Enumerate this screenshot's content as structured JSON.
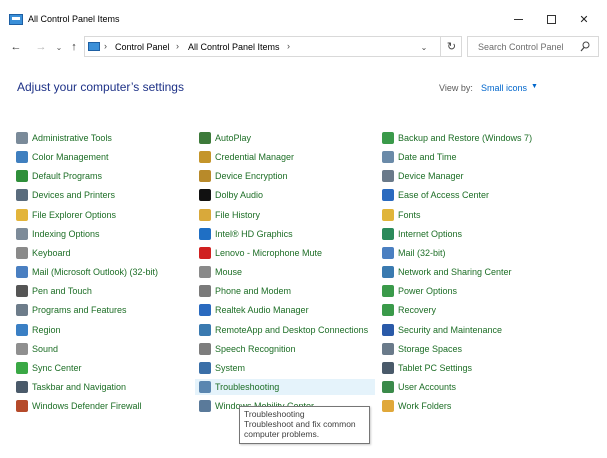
{
  "window": {
    "title": "All Control Panel Items",
    "minimize_glyph": "",
    "maximize_glyph": "",
    "close_glyph": "✕"
  },
  "navigation": {
    "back_glyph": "←",
    "forward_glyph": "→",
    "recent_glyph": "⌄",
    "up_glyph": "↑",
    "breadcrumb": [
      "Control Panel",
      "All Control Panel Items"
    ],
    "separator": "›",
    "dropdown_glyph": "⌄",
    "refresh_glyph": "↻",
    "search_placeholder": "Search Control Panel"
  },
  "header": {
    "title": "Adjust your computer’s settings",
    "view_by_label": "View by:",
    "view_by_value": "Small icons",
    "view_by_caret": "▼"
  },
  "columns": [
    [
      {
        "label": "Administrative Tools",
        "icon": "admin-tools-icon",
        "color": "#7a8a99"
      },
      {
        "label": "Color Management",
        "icon": "color-management-icon",
        "color": "#3f7fbf"
      },
      {
        "label": "Default Programs",
        "icon": "default-programs-icon",
        "color": "#2f8f3a"
      },
      {
        "label": "Devices and Printers",
        "icon": "devices-printers-icon",
        "color": "#5a6c7d"
      },
      {
        "label": "File Explorer Options",
        "icon": "folder-options-icon",
        "color": "#e3b53b"
      },
      {
        "label": "Indexing Options",
        "icon": "indexing-icon",
        "color": "#7d8b99"
      },
      {
        "label": "Keyboard",
        "icon": "keyboard-icon",
        "color": "#8a8a8a"
      },
      {
        "label": "Mail (Microsoft Outlook) (32-bit)",
        "icon": "mail-icon",
        "color": "#4a7fc1"
      },
      {
        "label": "Pen and Touch",
        "icon": "pen-icon",
        "color": "#555555"
      },
      {
        "label": "Programs and Features",
        "icon": "programs-features-icon",
        "color": "#6d7c8a"
      },
      {
        "label": "Region",
        "icon": "region-icon",
        "color": "#3a7fc4"
      },
      {
        "label": "Sound",
        "icon": "sound-icon",
        "color": "#8f8f8f"
      },
      {
        "label": "Sync Center",
        "icon": "sync-icon",
        "color": "#3aa845"
      },
      {
        "label": "Taskbar and Navigation",
        "icon": "taskbar-icon",
        "color": "#4a5a6a"
      },
      {
        "label": "Windows Defender Firewall",
        "icon": "firewall-icon",
        "color": "#b54a2a"
      }
    ],
    [
      {
        "label": "AutoPlay",
        "icon": "autoplay-icon",
        "color": "#3d7a3a"
      },
      {
        "label": "Credential Manager",
        "icon": "credential-icon",
        "color": "#c4952a"
      },
      {
        "label": "Device Encryption",
        "icon": "encryption-icon",
        "color": "#b88a2a"
      },
      {
        "label": "Dolby Audio",
        "icon": "dolby-icon",
        "color": "#111111"
      },
      {
        "label": "File History",
        "icon": "file-history-icon",
        "color": "#d9a93a"
      },
      {
        "label": "Intel® HD Graphics",
        "icon": "intel-graphics-icon",
        "color": "#1f6fc4"
      },
      {
        "label": "Lenovo - Microphone Mute",
        "icon": "lenovo-mic-icon",
        "color": "#d02020"
      },
      {
        "label": "Mouse",
        "icon": "mouse-icon",
        "color": "#8a8a8a"
      },
      {
        "label": "Phone and Modem",
        "icon": "phone-modem-icon",
        "color": "#7a7a7a"
      },
      {
        "label": "Realtek Audio Manager",
        "icon": "realtek-icon",
        "color": "#2a6abf"
      },
      {
        "label": "RemoteApp and Desktop Connections",
        "icon": "remoteapp-icon",
        "color": "#3a7ab0"
      },
      {
        "label": "Speech Recognition",
        "icon": "speech-icon",
        "color": "#7d7d7d"
      },
      {
        "label": "System",
        "icon": "system-icon",
        "color": "#3a6fa8"
      },
      {
        "label": "Troubleshooting",
        "icon": "troubleshooting-icon",
        "color": "#5a86b0"
      },
      {
        "label": "Windows Mobility Center",
        "icon": "mobility-icon",
        "color": "#5a7a9a"
      }
    ],
    [
      {
        "label": "Backup and Restore (Windows 7)",
        "icon": "backup-icon",
        "color": "#3a9a4a"
      },
      {
        "label": "Date and Time",
        "icon": "date-time-icon",
        "color": "#6a8aa8"
      },
      {
        "label": "Device Manager",
        "icon": "device-manager-icon",
        "color": "#6a7a8a"
      },
      {
        "label": "Ease of Access Center",
        "icon": "ease-access-icon",
        "color": "#2a6abf"
      },
      {
        "label": "Fonts",
        "icon": "fonts-icon",
        "color": "#e0b53a"
      },
      {
        "label": "Internet Options",
        "icon": "internet-options-icon",
        "color": "#2a8a5a"
      },
      {
        "label": "Mail (32-bit)",
        "icon": "mail-32-icon",
        "color": "#4a7fc1"
      },
      {
        "label": "Network and Sharing Center",
        "icon": "network-icon",
        "color": "#3a7ab0"
      },
      {
        "label": "Power Options",
        "icon": "power-icon",
        "color": "#3a9a4a"
      },
      {
        "label": "Recovery",
        "icon": "recovery-icon",
        "color": "#3a9a4a"
      },
      {
        "label": "Security and Maintenance",
        "icon": "security-flag-icon",
        "color": "#2a5aa8"
      },
      {
        "label": "Storage Spaces",
        "icon": "storage-icon",
        "color": "#6a7a8a"
      },
      {
        "label": "Tablet PC Settings",
        "icon": "tablet-icon",
        "color": "#4a5a6a"
      },
      {
        "label": "User Accounts",
        "icon": "user-accounts-icon",
        "color": "#3a8a4a"
      },
      {
        "label": "Work Folders",
        "icon": "work-folders-icon",
        "color": "#e0a83a"
      }
    ]
  ],
  "hovered_item": "Troubleshooting",
  "tooltip": {
    "title": "Troubleshooting",
    "line1": "Troubleshoot and fix common",
    "line2": "computer problems."
  }
}
